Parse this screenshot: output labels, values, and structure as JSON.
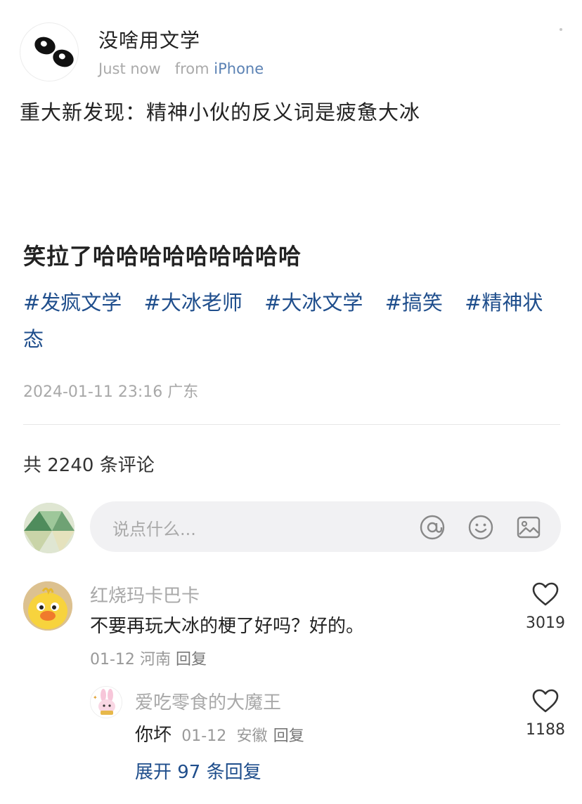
{
  "post": {
    "author": "没啥用文学",
    "time": "Just now",
    "from_label": "from",
    "device": "iPhone",
    "text": "重大新发现：精神小伙的反义词是疲惫大冰",
    "title": "笑拉了哈哈哈哈哈哈哈哈哈",
    "tags": [
      "#发疯文学",
      "#大冰老师",
      "#大冰文学",
      "#搞笑",
      "#精神状态"
    ],
    "timestamp": "2024-01-11 23:16 广东"
  },
  "comments_header": {
    "count_text": "共 2240 条评论"
  },
  "comment_input": {
    "placeholder": "说点什么...",
    "icons": [
      "at-icon",
      "emoji-icon",
      "image-icon"
    ]
  },
  "comments": [
    {
      "author": "红烧玛卡巴卡",
      "text": "不要再玩大冰的梗了好吗？好的。",
      "date": "01-12",
      "location": "河南",
      "reply_label": "回复",
      "likes": "3019"
    },
    {
      "author": "爱吃零食的大魔王",
      "text": "你坏",
      "date": "01-12",
      "location": "安徽",
      "reply_label": "回复",
      "likes": "1188"
    }
  ],
  "expand_replies": "展开 97 条回复",
  "colors": {
    "link": "#1f4e8c",
    "muted": "#a8a8a8",
    "device": "#5b82b4"
  }
}
